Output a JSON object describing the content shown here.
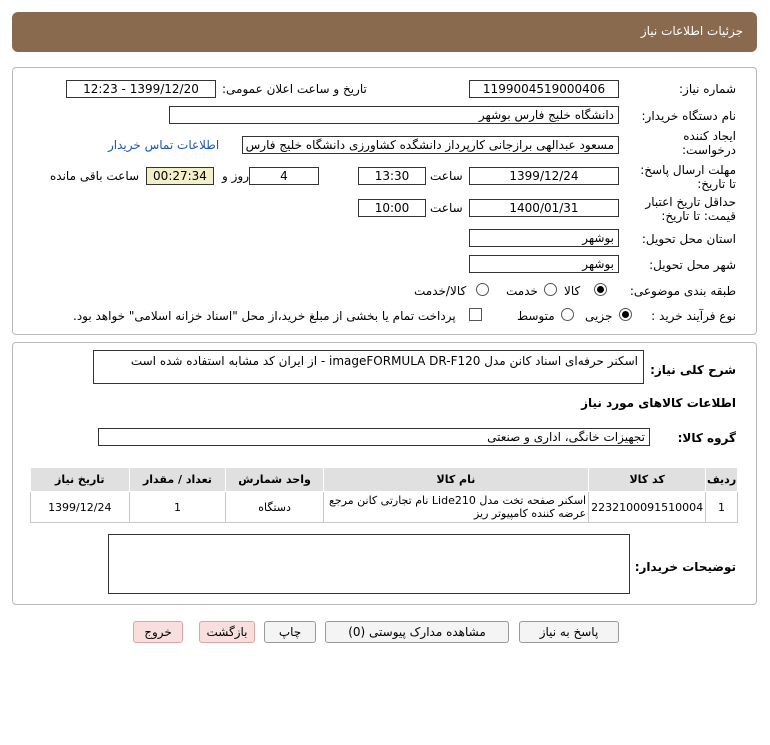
{
  "header": {
    "title": "جزئیات اطلاعات نیاز"
  },
  "fields": {
    "need_number_label": "شماره نیاز:",
    "need_number": "1199004519000406",
    "announce_label": "تاریخ و ساعت اعلان عمومی:",
    "announce_value": "1399/12/20 - 12:23",
    "buyer_org_label": "نام دستگاه خریدار:",
    "buyer_org": "دانشگاه خلیج فارس بوشهر",
    "creator_label_1": "ایجاد کننده",
    "creator_label_2": "درخواست:",
    "creator": "مسعود عبدالهی برازجانی کارپرداز دانشگده کشاورزی دانشگاه خلیج فارس بوشهر",
    "contact_link": "اطلاعات تماس خریدار",
    "deadline_label_1": "مهلت ارسال پاسخ:",
    "deadline_label_2": "تا تاریخ:",
    "deadline_date": "1399/12/24",
    "time_label": "ساعت",
    "deadline_time": "13:30",
    "days": "4",
    "days_label": "روز و",
    "remaining": "00:27:34",
    "remaining_label": "ساعت باقی مانده",
    "validity_label_1": "حداقل تاریخ اعتبار",
    "validity_label_2": "قیمت: تا تاریخ:",
    "validity_date": "1400/01/31",
    "validity_time": "10:00",
    "province_label": "استان محل تحویل:",
    "province": "بوشهر",
    "city_label": "شهر محل تحویل:",
    "city": "بوشهر",
    "category_label": "طبقه بندی موضوعی:",
    "category_options": [
      "کالا",
      "خدمت",
      "کالا/خدمت"
    ],
    "purchase_label": "نوع فرآیند خرید :",
    "purchase_options": [
      "جزیی",
      "متوسط"
    ],
    "treasury_note": "پرداخت تمام یا بخشی از مبلغ خرید،از محل \"اسناد خزانه اسلامی\" خواهد بود."
  },
  "summary": {
    "label": "شرح کلی نیاز:",
    "text": "اسکنر حرفه‌ای اسناد کانن مدل imageFORMULA DR-F120 - از ایران کد مشابه استفاده شده است"
  },
  "goods": {
    "section_title": "اطلاعات کالاهای مورد نیاز",
    "group_label": "گروه کالا:",
    "group_value": "تجهیزات خانگی، اداری و صنعتی",
    "columns": [
      "ردیف",
      "کد کالا",
      "نام کالا",
      "واحد شمارش",
      "تعداد / مقدار",
      "تاریخ نیاز"
    ],
    "rows": [
      {
        "row": "1",
        "code": "2232100091510004",
        "name": "اسکنر صفحه تخت مدل Lide210 نام تجارتی کانن مرجع عرضه کننده کامپیوتر ریز",
        "unit": "دستگاه",
        "qty": "1",
        "date": "1399/12/24"
      }
    ]
  },
  "buyer_notes": {
    "label": "توضیحات خریدار:",
    "value": ""
  },
  "buttons": {
    "reply": "پاسخ به نیاز",
    "docs": "مشاهده مدارک پیوستی (0)",
    "print": "چاپ",
    "back": "بازگشت",
    "exit": "خروج"
  },
  "colors": {
    "header": "#8a6a4e",
    "link": "#1b55b7",
    "remaining_bg": "#f2efc9",
    "back_btn": "#f9dede",
    "exit_btn": "#f9dede"
  }
}
